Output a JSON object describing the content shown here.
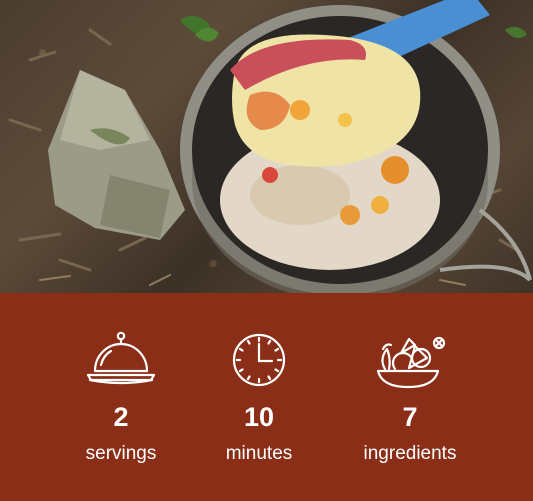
{
  "photo": {
    "subject": "photo",
    "icon": "food-photo"
  },
  "stats": [
    {
      "value": "2",
      "label": "servings",
      "icon": "serving-cloche-icon"
    },
    {
      "value": "10",
      "label": "minutes",
      "icon": "clock-icon"
    },
    {
      "value": "7",
      "label": "ingredients",
      "icon": "ingredients-bowl-icon"
    }
  ],
  "colors": {
    "band_background": "#8a2e17",
    "text": "#ffffff",
    "spoon": "#4a8fd4"
  }
}
